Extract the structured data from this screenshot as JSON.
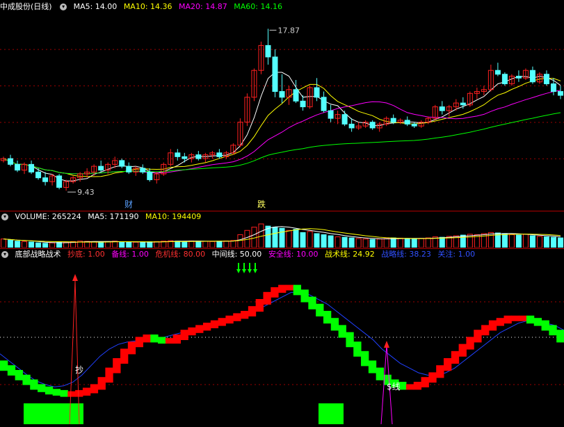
{
  "colors": {
    "bg": "#000000",
    "up": "#ff2020",
    "down": "#54ffff",
    "ma5": "#ffffff",
    "ma10": "#ffff00",
    "ma20": "#ff00ff",
    "ma60": "#00ff00",
    "grid": "#a00000"
  },
  "price_panel": {
    "stock_label": "中成股份(日线)",
    "ma5_label": "MA5: 14.00",
    "ma10_label": "MA10: 14.36",
    "ma20_label": "MA20: 14.87",
    "ma60_label": "MA60: 14.16",
    "high_label": "17.87",
    "low_label": "9.43",
    "marker_cai": "财",
    "marker_die": "跌"
  },
  "volume_panel": {
    "volume_label": "VOLUME: 265224",
    "ma5_label": "MA5: 171190",
    "ma10_label": "MA10: 194409"
  },
  "indicator_panel": {
    "title": "底部战略战术",
    "chaodi_label": "抄底: 1.00",
    "beixian_label": "备线: 1.00",
    "weiji_label": "危机线: 80.00",
    "zhongjian_label": "中间线: 50.00",
    "anquan_label": "安全线: 10.00",
    "zhanshu_label": "战术线: 24.92",
    "zhanlue_label": "战略线: 38.23",
    "guanzhu_label": "关注: 1.00",
    "mark_chao": "抄",
    "mark_cai": "$线"
  },
  "chart_data": [
    {
      "type": "candlestick",
      "title": "中成股份(日线)",
      "ylim": [
        9.0,
        18.5
      ],
      "values": [
        [
          11.0,
          11.2,
          10.9,
          11.1
        ],
        [
          11.1,
          11.3,
          10.7,
          10.8
        ],
        [
          10.8,
          11.0,
          10.4,
          10.5
        ],
        [
          10.5,
          10.9,
          10.3,
          10.8
        ],
        [
          10.8,
          11.0,
          10.3,
          10.4
        ],
        [
          10.4,
          10.6,
          10.0,
          10.1
        ],
        [
          10.1,
          10.4,
          9.7,
          9.9
        ],
        [
          9.9,
          10.3,
          9.7,
          10.2
        ],
        [
          10.2,
          10.3,
          9.5,
          9.6
        ],
        [
          9.6,
          10.0,
          9.43,
          9.9
        ],
        [
          9.9,
          10.2,
          9.8,
          10.1
        ],
        [
          10.1,
          10.4,
          9.9,
          10.3
        ],
        [
          10.3,
          10.6,
          10.1,
          10.4
        ],
        [
          10.4,
          10.8,
          10.2,
          10.7
        ],
        [
          10.7,
          11.0,
          10.4,
          10.5
        ],
        [
          10.5,
          10.9,
          10.3,
          10.8
        ],
        [
          10.8,
          11.2,
          10.6,
          11.0
        ],
        [
          11.0,
          11.1,
          10.6,
          10.7
        ],
        [
          10.7,
          10.9,
          10.3,
          10.4
        ],
        [
          10.4,
          10.7,
          10.2,
          10.6
        ],
        [
          10.6,
          10.8,
          10.3,
          10.4
        ],
        [
          10.4,
          10.6,
          9.9,
          10.0
        ],
        [
          10.0,
          10.4,
          9.8,
          10.3
        ],
        [
          10.3,
          10.9,
          10.2,
          10.8
        ],
        [
          10.8,
          11.6,
          10.7,
          11.4
        ],
        [
          11.4,
          11.6,
          11.0,
          11.2
        ],
        [
          11.2,
          11.4,
          10.9,
          11.1
        ],
        [
          11.1,
          11.4,
          10.9,
          11.3
        ],
        [
          11.3,
          11.5,
          11.0,
          11.1
        ],
        [
          11.1,
          11.4,
          10.9,
          11.3
        ],
        [
          11.3,
          11.5,
          11.1,
          11.4
        ],
        [
          11.4,
          11.6,
          11.1,
          11.2
        ],
        [
          11.2,
          11.5,
          11.1,
          11.4
        ],
        [
          11.4,
          11.9,
          11.3,
          11.8
        ],
        [
          11.8,
          13.2,
          11.7,
          13.0
        ],
        [
          13.0,
          14.5,
          12.8,
          14.3
        ],
        [
          14.3,
          15.8,
          14.1,
          15.7
        ],
        [
          15.7,
          17.2,
          15.5,
          17.0
        ],
        [
          17.0,
          17.87,
          16.0,
          16.4
        ],
        [
          16.4,
          16.8,
          14.3,
          14.6
        ],
        [
          14.6,
          15.5,
          14.0,
          14.3
        ],
        [
          14.3,
          14.9,
          13.9,
          14.7
        ],
        [
          14.7,
          15.2,
          14.0,
          14.1
        ],
        [
          14.1,
          14.4,
          13.6,
          13.8
        ],
        [
          13.8,
          14.9,
          13.7,
          14.8
        ],
        [
          14.8,
          15.3,
          14.1,
          14.3
        ],
        [
          14.3,
          14.6,
          13.5,
          13.6
        ],
        [
          13.6,
          13.9,
          13.0,
          13.2
        ],
        [
          13.2,
          13.6,
          12.9,
          13.4
        ],
        [
          13.4,
          13.6,
          12.8,
          12.9
        ],
        [
          12.9,
          13.2,
          12.5,
          12.7
        ],
        [
          12.7,
          13.0,
          12.6,
          12.8
        ],
        [
          12.8,
          13.1,
          12.7,
          13.0
        ],
        [
          13.0,
          13.1,
          12.6,
          12.7
        ],
        [
          12.7,
          13.0,
          12.5,
          12.9
        ],
        [
          12.9,
          13.3,
          12.8,
          13.2
        ],
        [
          13.2,
          13.4,
          12.9,
          13.0
        ],
        [
          13.0,
          13.2,
          12.9,
          13.1
        ],
        [
          13.1,
          13.3,
          12.8,
          12.9
        ],
        [
          12.9,
          13.0,
          12.7,
          12.8
        ],
        [
          12.8,
          13.1,
          12.7,
          13.0
        ],
        [
          13.0,
          13.3,
          12.9,
          13.2
        ],
        [
          13.2,
          13.9,
          13.1,
          13.8
        ],
        [
          13.8,
          14.1,
          13.4,
          13.6
        ],
        [
          13.6,
          13.9,
          13.3,
          13.8
        ],
        [
          13.8,
          14.2,
          13.6,
          14.0
        ],
        [
          14.0,
          14.3,
          13.7,
          13.9
        ],
        [
          13.9,
          14.6,
          13.8,
          14.5
        ],
        [
          14.5,
          14.8,
          14.2,
          14.6
        ],
        [
          14.6,
          14.9,
          14.4,
          14.7
        ],
        [
          14.7,
          16.0,
          14.6,
          15.7
        ],
        [
          15.7,
          16.1,
          15.4,
          15.5
        ],
        [
          15.5,
          15.6,
          14.9,
          15.0
        ],
        [
          15.0,
          15.5,
          14.9,
          15.4
        ],
        [
          15.4,
          15.7,
          15.1,
          15.3
        ],
        [
          15.3,
          15.8,
          15.2,
          15.7
        ],
        [
          15.7,
          15.9,
          15.0,
          15.1
        ],
        [
          15.1,
          15.6,
          15.0,
          15.5
        ],
        [
          15.5,
          15.7,
          14.9,
          15.0
        ],
        [
          15.0,
          15.3,
          14.4,
          14.6
        ],
        [
          14.6,
          14.9,
          14.2,
          14.4
        ]
      ],
      "ma_levels": {
        "MA5": 14.0,
        "MA10": 14.36,
        "MA20": 14.87,
        "MA60": 14.16
      },
      "annotations": [
        "17.87",
        "9.43",
        "财",
        "跌"
      ]
    },
    {
      "type": "bar",
      "title": "VOLUME",
      "values": [
        40,
        35,
        30,
        28,
        26,
        22,
        20,
        22,
        24,
        26,
        28,
        30,
        29,
        27,
        26,
        28,
        30,
        26,
        24,
        25,
        26,
        27,
        28,
        30,
        32,
        30,
        29,
        31,
        30,
        29,
        28,
        30,
        31,
        33,
        60,
        80,
        95,
        110,
        100,
        95,
        90,
        80,
        85,
        70,
        75,
        65,
        60,
        55,
        50,
        48,
        45,
        42,
        40,
        38,
        40,
        42,
        45,
        44,
        42,
        40,
        43,
        45,
        50,
        48,
        52,
        55,
        58,
        62,
        60,
        65,
        70,
        68,
        64,
        60,
        58,
        62,
        55,
        52,
        50,
        48,
        45
      ]
    },
    {
      "type": "line",
      "title": "底部战略战术",
      "ylim": [
        0,
        100
      ],
      "series": [
        {
          "name": "战术线",
          "values": [
            28,
            24,
            20,
            16,
            12,
            8,
            6,
            4,
            3,
            2,
            2,
            3,
            5,
            8,
            14,
            22,
            30,
            38,
            44,
            48,
            50,
            48,
            47,
            47,
            50,
            54,
            56,
            58,
            60,
            62,
            64,
            66,
            68,
            70,
            74,
            80,
            86,
            90,
            92,
            92,
            88,
            82,
            76,
            70,
            64,
            58,
            52,
            44,
            36,
            28,
            22,
            16,
            12,
            10,
            8,
            8,
            10,
            14,
            18,
            24,
            30,
            36,
            42,
            48,
            54,
            58,
            62,
            64,
            66,
            66,
            66,
            64,
            62,
            58,
            54,
            48
          ]
        },
        {
          "name": "战略线",
          "values": [
            36,
            30,
            24,
            18,
            13,
            10,
            8,
            9,
            12,
            18,
            26,
            34,
            40,
            44,
            46,
            47,
            48,
            49,
            50,
            52,
            54,
            56,
            58,
            60,
            62,
            64,
            66,
            68,
            72,
            76,
            80,
            84,
            88,
            88,
            86,
            82,
            78,
            72,
            66,
            60,
            54,
            48,
            40,
            34,
            28,
            24,
            20,
            18,
            18,
            20,
            24,
            30,
            36,
            42,
            48,
            54,
            58,
            62,
            64,
            64,
            62,
            60,
            56
          ]
        }
      ],
      "levels": {
        "危机线": 80,
        "中间线": 50,
        "安全线": 10
      }
    }
  ]
}
